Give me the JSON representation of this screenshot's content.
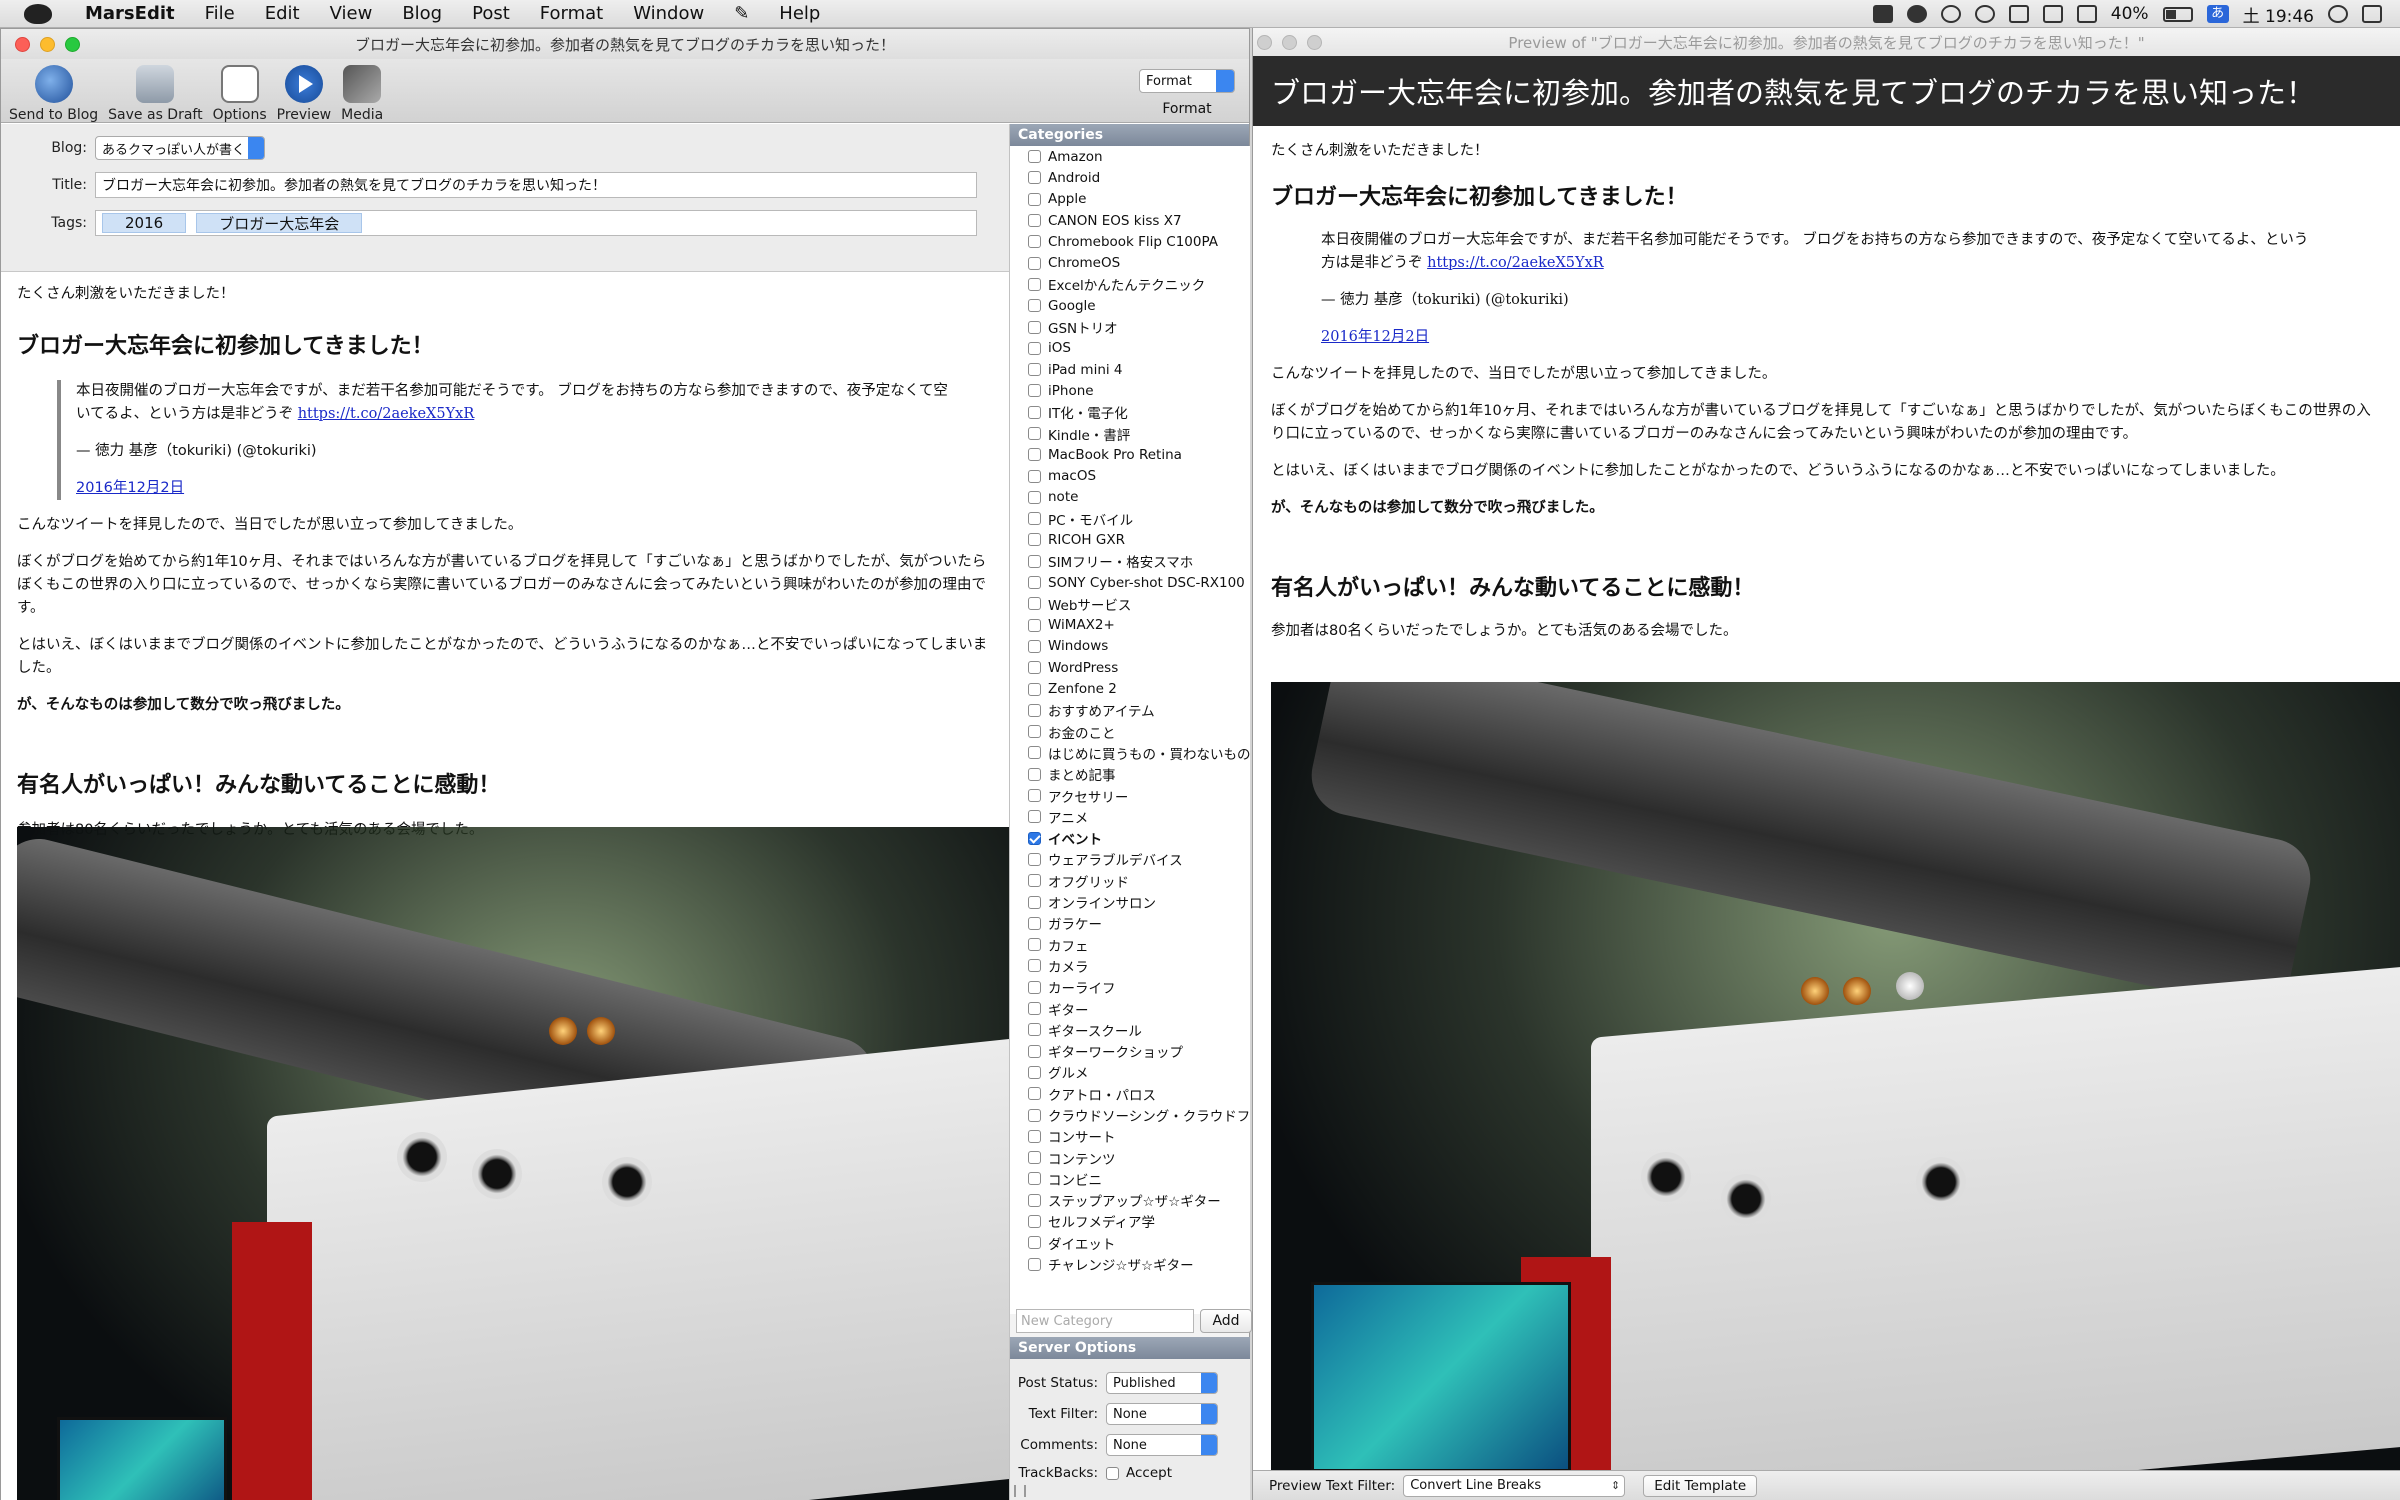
{
  "menubar": {
    "app": "MarsEdit",
    "items": [
      "File",
      "Edit",
      "View",
      "Blog",
      "Post",
      "Format",
      "Window",
      "Help"
    ],
    "battery": "40%",
    "input_method": "あ",
    "clock": "土 19:46"
  },
  "editor": {
    "window_title": "ブロガー大忘年会に初参加。参加者の熱気を見てブログのチカラを思い知った！",
    "toolbar": {
      "send": "Send to Blog",
      "draft": "Save as Draft",
      "options": "Options",
      "preview": "Preview",
      "media": "Media",
      "format_value": "Format",
      "format_label": "Format"
    },
    "fields": {
      "blog_label": "Blog:",
      "blog_value": "あるクマっぽい人が書く",
      "title_label": "Title:",
      "title_value": "ブロガー大忘年会に初参加。参加者の熱気を見てブログのチカラを思い知った！",
      "tags_label": "Tags:",
      "tags": [
        "2016",
        "ブロガー大忘年会"
      ]
    }
  },
  "post": {
    "intro": "たくさん刺激をいただきました！",
    "h1": "ブロガー大忘年会に初参加してきました！",
    "quote_line1": "本日夜開催のブロガー大忘年会ですが、まだ若干名参加可能だそうです。 ブログをお持ちの方なら参加できますので、夜予定なくて空いてるよ、という方は是非どうぞ ",
    "quote_link": "https://t.co/2aekeX5YxR",
    "quote_author": "— 徳力 基彦（tokuriki) (@tokuriki)",
    "quote_date": "2016年12月2日",
    "p1": "こんなツイートを拝見したので、当日でしたが思い立って参加してきました。",
    "p2": "ぼくがブログを始めてから約1年10ヶ月、それまではいろんな方が書いているブログを拝見して「すごいなぁ」と思うばかりでしたが、気がついたらぼくもこの世界の入り口に立っているので、せっかくなら実際に書いているブロガーのみなさんに会ってみたいという興味がわいたのが参加の理由です。",
    "p3": "とはいえ、ぼくはいままでブログ関係のイベントに参加したことがなかったので、どういうふうになるのかなぁ…と不安でいっぱいになってしまいました。",
    "p4": "が、そんなものは参加して数分で吹っ飛びました。",
    "h2": "有名人がいっぱい！みんな動いてることに感動！",
    "p5": "参加者は80名くらいだったでしょうか。とても活気のある会場でした。"
  },
  "categories": {
    "header": "Categories",
    "items": [
      {
        "label": "Amazon",
        "checked": false
      },
      {
        "label": "Android",
        "checked": false
      },
      {
        "label": "Apple",
        "checked": false
      },
      {
        "label": "CANON EOS kiss X7",
        "checked": false
      },
      {
        "label": "Chromebook Flip C100PA",
        "checked": false
      },
      {
        "label": "ChromeOS",
        "checked": false
      },
      {
        "label": "Excelかんたんテクニック",
        "checked": false
      },
      {
        "label": "Google",
        "checked": false
      },
      {
        "label": "GSNトリオ",
        "checked": false
      },
      {
        "label": "iOS",
        "checked": false
      },
      {
        "label": "iPad mini 4",
        "checked": false
      },
      {
        "label": "iPhone",
        "checked": false
      },
      {
        "label": "IT化・電子化",
        "checked": false
      },
      {
        "label": "Kindle・書評",
        "checked": false
      },
      {
        "label": "MacBook Pro Retina",
        "checked": false
      },
      {
        "label": "macOS",
        "checked": false
      },
      {
        "label": "note",
        "checked": false
      },
      {
        "label": "PC・モバイル",
        "checked": false
      },
      {
        "label": "RICOH GXR",
        "checked": false
      },
      {
        "label": "SIMフリー・格安スマホ",
        "checked": false
      },
      {
        "label": "SONY Cyber-shot DSC-RX100",
        "checked": false
      },
      {
        "label": "Webサービス",
        "checked": false
      },
      {
        "label": "WiMAX2+",
        "checked": false
      },
      {
        "label": "Windows",
        "checked": false
      },
      {
        "label": "WordPress",
        "checked": false
      },
      {
        "label": "Zenfone 2",
        "checked": false
      },
      {
        "label": "おすすめアイテム",
        "checked": false
      },
      {
        "label": "お金のこと",
        "checked": false
      },
      {
        "label": "はじめに買うもの・買わないもの",
        "checked": false
      },
      {
        "label": "まとめ記事",
        "checked": false
      },
      {
        "label": "アクセサリー",
        "checked": false
      },
      {
        "label": "アニメ",
        "checked": false
      },
      {
        "label": "イベント",
        "checked": true
      },
      {
        "label": "ウェアラブルデバイス",
        "checked": false
      },
      {
        "label": "オフグリッド",
        "checked": false
      },
      {
        "label": "オンラインサロン",
        "checked": false
      },
      {
        "label": "ガラケー",
        "checked": false
      },
      {
        "label": "カフェ",
        "checked": false
      },
      {
        "label": "カメラ",
        "checked": false
      },
      {
        "label": "カーライフ",
        "checked": false
      },
      {
        "label": "ギター",
        "checked": false
      },
      {
        "label": "ギタースクール",
        "checked": false
      },
      {
        "label": "ギターワークショップ",
        "checked": false
      },
      {
        "label": "グルメ",
        "checked": false
      },
      {
        "label": "クアトロ・パロス",
        "checked": false
      },
      {
        "label": "クラウドソーシング・クラウドファンディング",
        "checked": false
      },
      {
        "label": "コンサート",
        "checked": false
      },
      {
        "label": "コンテンツ",
        "checked": false
      },
      {
        "label": "コンビニ",
        "checked": false
      },
      {
        "label": "ステップアップ☆ザ☆ギター",
        "checked": false
      },
      {
        "label": "セルフメディア学",
        "checked": false
      },
      {
        "label": "ダイエット",
        "checked": false
      },
      {
        "label": "チャレンジ☆ザ☆ギター",
        "checked": false
      }
    ],
    "new_placeholder": "New Category",
    "add": "Add"
  },
  "server_options": {
    "header": "Server Options",
    "post_status_label": "Post Status:",
    "post_status": "Published",
    "text_filter_label": "Text Filter:",
    "text_filter": "None",
    "comments_label": "Comments:",
    "comments": "None",
    "trackbacks_label": "TrackBacks:",
    "accept": "Accept"
  },
  "preview": {
    "window_title": "Preview of \"ブロガー大忘年会に初参加。参加者の熱気を見てブログのチカラを思い知った！\"",
    "header": "ブロガー大忘年会に初参加。参加者の熱気を見てブログのチカラを思い知った！",
    "filter_label": "Preview Text Filter:",
    "filter_value": "Convert Line Breaks",
    "edit_template": "Edit Template"
  },
  "colors": {
    "accent": "#3b86f0",
    "link": "#1a29c8",
    "preview_header_bg": "#2b2b2b",
    "panel_header": "#8591a3"
  }
}
